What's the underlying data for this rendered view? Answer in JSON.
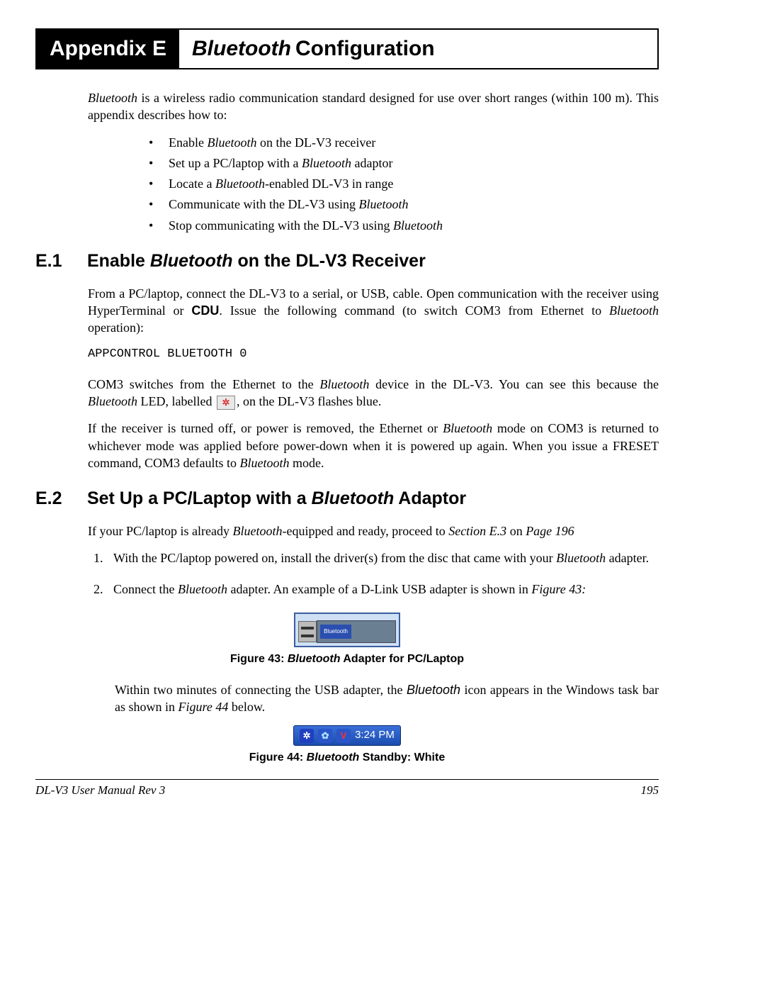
{
  "header": {
    "appendix_label": "Appendix E",
    "title_bt": "Bluetooth",
    "title_rest": "Configuration"
  },
  "intro": {
    "p1_a": "Bluetooth",
    "p1_b": " is a wireless radio communication standard designed for use over short ranges (within 100 m). This appendix describes how to:"
  },
  "bullets": [
    {
      "pre": "Enable ",
      "bt": "Bluetooth",
      "post": " on the DL-V3 receiver"
    },
    {
      "pre": "Set up a PC/laptop with a ",
      "bt": "Bluetooth",
      "post": " adaptor"
    },
    {
      "pre": "Locate a ",
      "bt": "Bluetooth",
      "post": "-enabled DL-V3 in range"
    },
    {
      "pre": "Communicate with the DL-V3 using ",
      "bt": "Bluetooth",
      "post": ""
    },
    {
      "pre": "Stop communicating with the DL-V3 using ",
      "bt": "Bluetooth",
      "post": ""
    }
  ],
  "e1": {
    "num": "E.1",
    "title_a": "Enable ",
    "title_bt": "Bluetooth",
    "title_b": " on the DL-V3 Receiver",
    "p1": "From a PC/laptop, connect the DL-V3 to a serial, or USB, cable. Open communication with the receiver using HyperTerminal or ",
    "p1_bold": "CDU",
    "p1_b": ". Issue the following command (to switch COM3 from Ethernet to ",
    "p1_bt": "Bluetooth",
    "p1_c": " operation):",
    "cmd": "APPCONTROL BLUETOOTH 0",
    "p2_a": "COM3 switches from the Ethernet to the ",
    "p2_bt": "Bluetooth",
    "p2_b": " device in the DL-V3. You can see this because the ",
    "p2_bt2": "Bluetooth",
    "p2_c": " LED, labelled ",
    "p2_d": ", on the DL-V3 flashes blue.",
    "p3_a": "If the receiver is turned off, or power is removed, the Ethernet or ",
    "p3_bt": "Bluetooth",
    "p3_b": " mode on COM3 is returned to whichever mode was applied before power-down when it is powered up again. When you issue a FRESET command, COM3 defaults to ",
    "p3_bt2": "Bluetooth",
    "p3_c": " mode."
  },
  "e2": {
    "num": "E.2",
    "title_a": "Set Up a PC/Laptop with a ",
    "title_bt": "Bluetooth",
    "title_b": " Adaptor",
    "p1_a": "If your PC/laptop is already ",
    "p1_bt": "Bluetooth",
    "p1_b": "-equipped and ready, proceed to ",
    "p1_ref": "Section E.3",
    "p1_c": " on ",
    "p1_page": "Page 196",
    "step1_a": "With the PC/laptop powered on, install the driver(s) from the disc that came with your ",
    "step1_bt": "Bluetooth",
    "step1_b": " adapter.",
    "step2_a": "Connect the ",
    "step2_bt": "Bluetooth",
    "step2_b": " adapter. An example of a D-Link USB adapter is shown in ",
    "step2_ref": "Figure 43:",
    "fig43_label": "Figure 43: ",
    "fig43_bt": "Bluetooth",
    "fig43_rest": " Adapter for PC/Laptop",
    "p_after_a": "Within two minutes of connecting the USB adapter, the ",
    "p_after_bt": "Bluetooth",
    "p_after_b": " icon appears in the Windows task bar as shown in ",
    "p_after_ref": "Figure 44",
    "p_after_c": " below.",
    "tray_time": "3:24 PM",
    "fig44_label": "Figure 44: ",
    "fig44_bt": "Bluetooth",
    "fig44_rest": " Standby: White"
  },
  "footer": {
    "left": "DL-V3 User Manual Rev 3",
    "right": "195"
  },
  "icons": {
    "bt_glyph": "✲",
    "usb_label": "Bluetooth"
  }
}
